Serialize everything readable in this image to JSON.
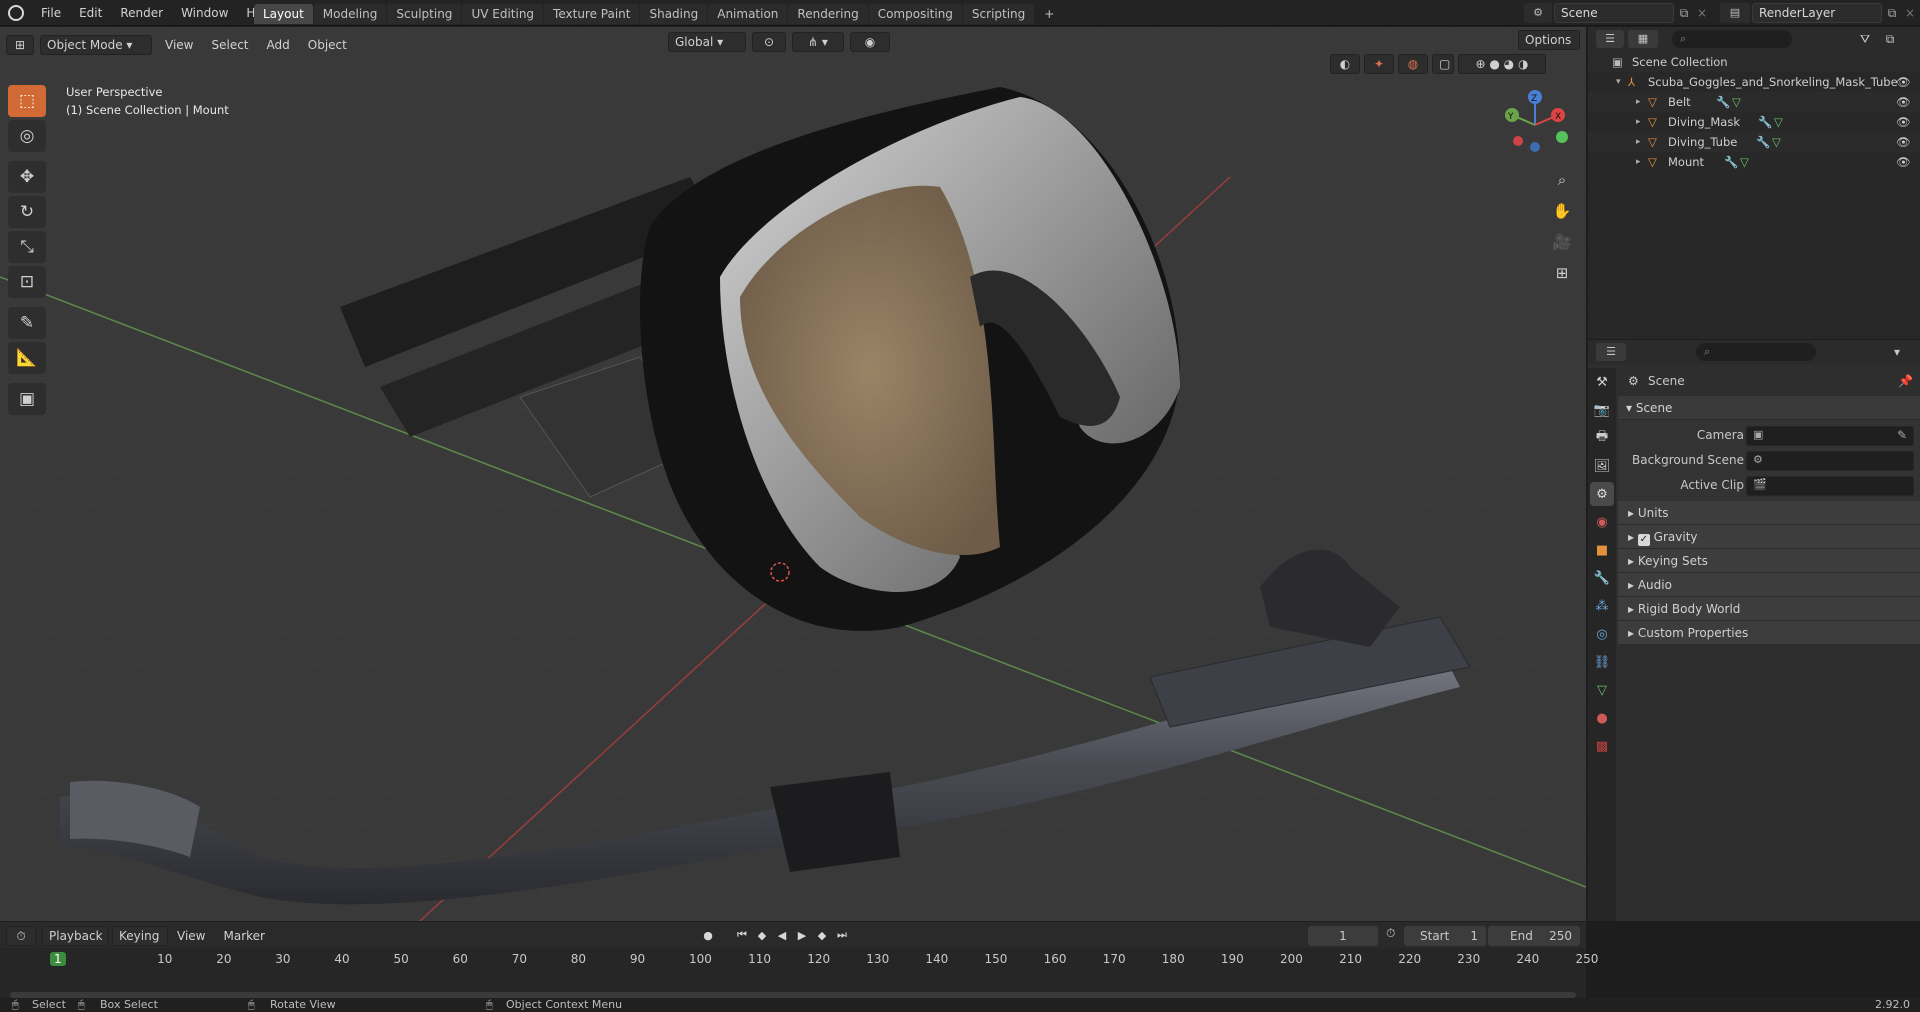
{
  "topbar": {
    "menus": [
      "File",
      "Edit",
      "Render",
      "Window",
      "Help"
    ],
    "tabs": [
      "Layout",
      "Modeling",
      "Sculpting",
      "UV Editing",
      "Texture Paint",
      "Shading",
      "Animation",
      "Rendering",
      "Compositing",
      "Scripting"
    ],
    "active_tab": "Layout",
    "add_tab": "+",
    "scene": "Scene",
    "render_layer": "RenderLayer"
  },
  "viewport": {
    "mode": "Object Mode",
    "menus": [
      "View",
      "Select",
      "Add",
      "Object"
    ],
    "orientation": "Global",
    "options": "Options",
    "overlay_line1": "User Perspective",
    "overlay_line2": "(1) Scene Collection | Mount",
    "gizmo_labels": {
      "z": "Z",
      "y": "Y",
      "x": "X"
    }
  },
  "outliner": {
    "root": "Scene Collection",
    "collection": "Scuba_Goggles_and_Snorkeling_Mask_Tube",
    "objects": [
      "Belt",
      "Diving_Mask",
      "Diving_Tube",
      "Mount"
    ]
  },
  "properties": {
    "context": "Scene",
    "panel": "Scene",
    "fields": [
      {
        "label": "Camera"
      },
      {
        "label": "Background Scene"
      },
      {
        "label": "Active Clip"
      }
    ],
    "subpanels": [
      "Units",
      "Gravity",
      "Keying Sets",
      "Audio",
      "Rigid Body World",
      "Custom Properties"
    ],
    "gravity_checked": true
  },
  "timeline": {
    "menus": [
      "Playback",
      "Keying",
      "View",
      "Marker"
    ],
    "current_frame": "1",
    "start_label": "Start",
    "start": "1",
    "end_label": "End",
    "end": "250",
    "ticks": [
      "1",
      "10",
      "20",
      "30",
      "40",
      "50",
      "60",
      "70",
      "80",
      "90",
      "100",
      "110",
      "120",
      "130",
      "140",
      "150",
      "160",
      "170",
      "180",
      "190",
      "200",
      "210",
      "220",
      "230",
      "240",
      "250"
    ]
  },
  "statusbar": {
    "select": "Select",
    "box_select": "Box Select",
    "rotate": "Rotate View",
    "context_menu": "Object Context Menu",
    "version": "2.92.0"
  },
  "colors": {
    "accent": "#d26a36",
    "active_tab": "#474747",
    "viewport_bg": "#393939"
  }
}
